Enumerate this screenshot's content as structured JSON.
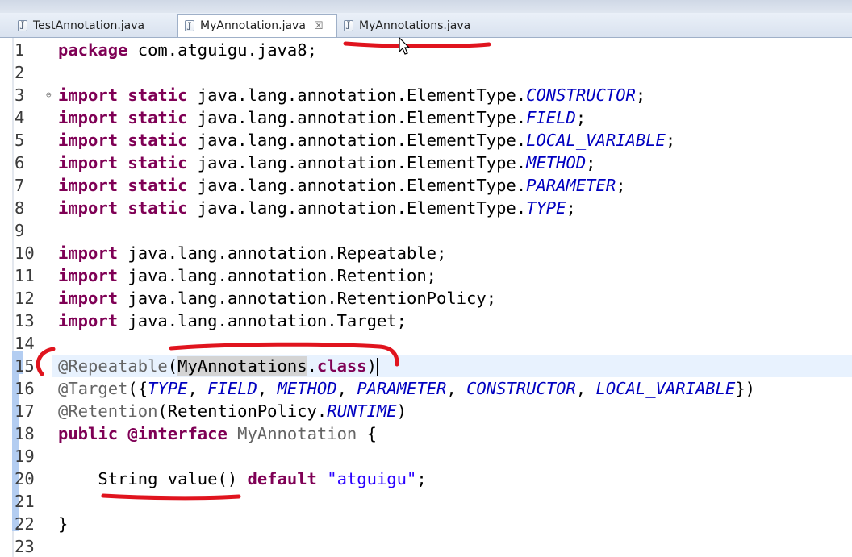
{
  "tabs": [
    {
      "label": "TestAnnotation.java",
      "icon": "java-file-icon",
      "active": false
    },
    {
      "label": "MyAnnotation.java",
      "icon": "java-file-icon",
      "active": true,
      "close_glyph": "☒"
    },
    {
      "label": "MyAnnotations.java",
      "icon": "java-file-icon",
      "active": false
    }
  ],
  "icon_letter": "J",
  "colors": {
    "keyword": "#7f0055",
    "annotation": "#646464",
    "constant": "#0000c0",
    "string": "#2a00ff",
    "markup": "#e0141e",
    "current_line": "#e8f2fe"
  },
  "editor": {
    "current_line": 15,
    "lines": [
      {
        "n": "1",
        "tokens": [
          [
            "kw",
            "package"
          ],
          [
            "pl",
            " com.atguigu.java8;"
          ]
        ]
      },
      {
        "n": "2",
        "tokens": []
      },
      {
        "n": "3",
        "fold": "⊖",
        "tokens": [
          [
            "kw",
            "import"
          ],
          [
            "pl",
            " "
          ],
          [
            "kw",
            "static"
          ],
          [
            "pl",
            " java.lang.annotation.ElementType."
          ],
          [
            "const",
            "CONSTRUCTOR"
          ],
          [
            "pl",
            ";"
          ]
        ]
      },
      {
        "n": "4",
        "tokens": [
          [
            "kw",
            "import"
          ],
          [
            "pl",
            " "
          ],
          [
            "kw",
            "static"
          ],
          [
            "pl",
            " java.lang.annotation.ElementType."
          ],
          [
            "const",
            "FIELD"
          ],
          [
            "pl",
            ";"
          ]
        ]
      },
      {
        "n": "5",
        "tokens": [
          [
            "kw",
            "import"
          ],
          [
            "pl",
            " "
          ],
          [
            "kw",
            "static"
          ],
          [
            "pl",
            " java.lang.annotation.ElementType."
          ],
          [
            "const",
            "LOCAL_VARIABLE"
          ],
          [
            "pl",
            ";"
          ]
        ]
      },
      {
        "n": "6",
        "tokens": [
          [
            "kw",
            "import"
          ],
          [
            "pl",
            " "
          ],
          [
            "kw",
            "static"
          ],
          [
            "pl",
            " java.lang.annotation.ElementType."
          ],
          [
            "const",
            "METHOD"
          ],
          [
            "pl",
            ";"
          ]
        ]
      },
      {
        "n": "7",
        "tokens": [
          [
            "kw",
            "import"
          ],
          [
            "pl",
            " "
          ],
          [
            "kw",
            "static"
          ],
          [
            "pl",
            " java.lang.annotation.ElementType."
          ],
          [
            "const",
            "PARAMETER"
          ],
          [
            "pl",
            ";"
          ]
        ]
      },
      {
        "n": "8",
        "tokens": [
          [
            "kw",
            "import"
          ],
          [
            "pl",
            " "
          ],
          [
            "kw",
            "static"
          ],
          [
            "pl",
            " java.lang.annotation.ElementType."
          ],
          [
            "const",
            "TYPE"
          ],
          [
            "pl",
            ";"
          ]
        ]
      },
      {
        "n": "9",
        "tokens": []
      },
      {
        "n": "10",
        "tokens": [
          [
            "kw",
            "import"
          ],
          [
            "pl",
            " java.lang.annotation.Repeatable;"
          ]
        ]
      },
      {
        "n": "11",
        "tokens": [
          [
            "kw",
            "import"
          ],
          [
            "pl",
            " java.lang.annotation.Retention;"
          ]
        ]
      },
      {
        "n": "12",
        "tokens": [
          [
            "kw",
            "import"
          ],
          [
            "pl",
            " java.lang.annotation.RetentionPolicy;"
          ]
        ]
      },
      {
        "n": "13",
        "tokens": [
          [
            "kw",
            "import"
          ],
          [
            "pl",
            " java.lang.annotation.Target;"
          ]
        ]
      },
      {
        "n": "14",
        "tokens": []
      },
      {
        "n": "15",
        "tokens": [
          [
            "anno",
            "@Repeatable"
          ],
          [
            "pl",
            "("
          ],
          [
            "hl",
            "MyAnnotations"
          ],
          [
            "pl",
            "."
          ],
          [
            "kw",
            "class"
          ],
          [
            "pl",
            ")"
          ],
          [
            "caret",
            ""
          ]
        ]
      },
      {
        "n": "16",
        "tokens": [
          [
            "anno",
            "@Target"
          ],
          [
            "pl",
            "({"
          ],
          [
            "const",
            "TYPE"
          ],
          [
            "pl",
            ", "
          ],
          [
            "const",
            "FIELD"
          ],
          [
            "pl",
            ", "
          ],
          [
            "const",
            "METHOD"
          ],
          [
            "pl",
            ", "
          ],
          [
            "const",
            "PARAMETER"
          ],
          [
            "pl",
            ", "
          ],
          [
            "const",
            "CONSTRUCTOR"
          ],
          [
            "pl",
            ", "
          ],
          [
            "const",
            "LOCAL_VARIABLE"
          ],
          [
            "pl",
            "})"
          ]
        ]
      },
      {
        "n": "17",
        "tokens": [
          [
            "anno",
            "@Retention"
          ],
          [
            "pl",
            "(RetentionPolicy."
          ],
          [
            "const",
            "RUNTIME"
          ],
          [
            "pl",
            ")"
          ]
        ]
      },
      {
        "n": "18",
        "tokens": [
          [
            "kw",
            "public"
          ],
          [
            "pl",
            " "
          ],
          [
            "kw",
            "@interface"
          ],
          [
            "pl",
            " "
          ],
          [
            "anno",
            "MyAnnotation"
          ],
          [
            "pl",
            " {"
          ]
        ]
      },
      {
        "n": "19",
        "tokens": []
      },
      {
        "n": "20",
        "tokens": [
          [
            "pl",
            "    String value() "
          ],
          [
            "kw",
            "default"
          ],
          [
            "pl",
            " "
          ],
          [
            "str",
            "\"atguigu\""
          ],
          [
            "pl",
            ";"
          ]
        ]
      },
      {
        "n": "21",
        "tokens": []
      },
      {
        "n": "22",
        "tokens": [
          [
            "pl",
            "}"
          ]
        ]
      },
      {
        "n": "23",
        "tokens": []
      }
    ]
  }
}
